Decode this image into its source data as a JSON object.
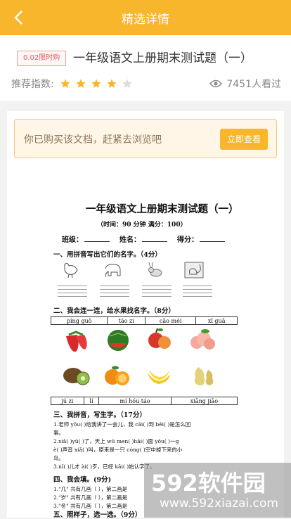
{
  "header": {
    "title": "精选详情",
    "back_icon": "chevron-left-icon"
  },
  "document": {
    "badge": "0.02限时购",
    "title": "一年级语文上册期末测试题（一）",
    "rating_label": "推荐指数:",
    "rating": 4,
    "rating_max": 5,
    "views": "7451人看过"
  },
  "notice": {
    "text": "你已购买该文档，赶紧去浏览吧",
    "button": "立即查看"
  },
  "paper": {
    "title": "一年级语文上册期末测试题（一）",
    "subtitle": "（时间：90 分钟  满分：100）",
    "fields": [
      "班级：",
      "姓名：",
      "得分："
    ],
    "q1": "一、用拼音写出它们的名字。（4分）",
    "q2": "二、我会连一连，给水果找名字。（8分）",
    "pinyin_top": [
      "píng  guǒ",
      "táo  zi",
      "cǎo  méi",
      "xī  guā"
    ],
    "pinyin_bottom": [
      "jú  zi",
      "lí",
      "mí  hóu  táo",
      "xiāng  jiāo"
    ],
    "q3": "三、我拼音，写生字。（17分）",
    "q3_lines": [
      "1.老师 yǒu(    )给我讲了一会儿，我 cāi(    )到  běi(    )是怎么回",
      "事。",
      "2.xiǎ(    )yǔ(    )了，天上 wū  men(    )hǎi(    )面 yǒu(    )一g",
      "è(    )声音 xiǎ(    )叫，原来是一只 cóng(    )空中掉下来的小",
      "鸟。",
      "3.nǐ(    )儿才 ài(    )歹，已经 kāi(    )始认字了。"
    ],
    "q4": "四、我会填。(9分)",
    "q4_lines": [
      "1.\"几\" 共有几画（    ），第二画是",
      "2.\"岁\" 共有几画（    ），第二画是",
      "3.\"冬\" 共有几画（    ），第二画是"
    ],
    "q5": "五、照样子，选一选。（9分）"
  },
  "watermark": {
    "big": "592软件园",
    "small": "www.592xiazai.com"
  },
  "colors": {
    "accent": "#f8b62d",
    "star_on": "#f8b62d",
    "star_off": "#dddddd"
  }
}
